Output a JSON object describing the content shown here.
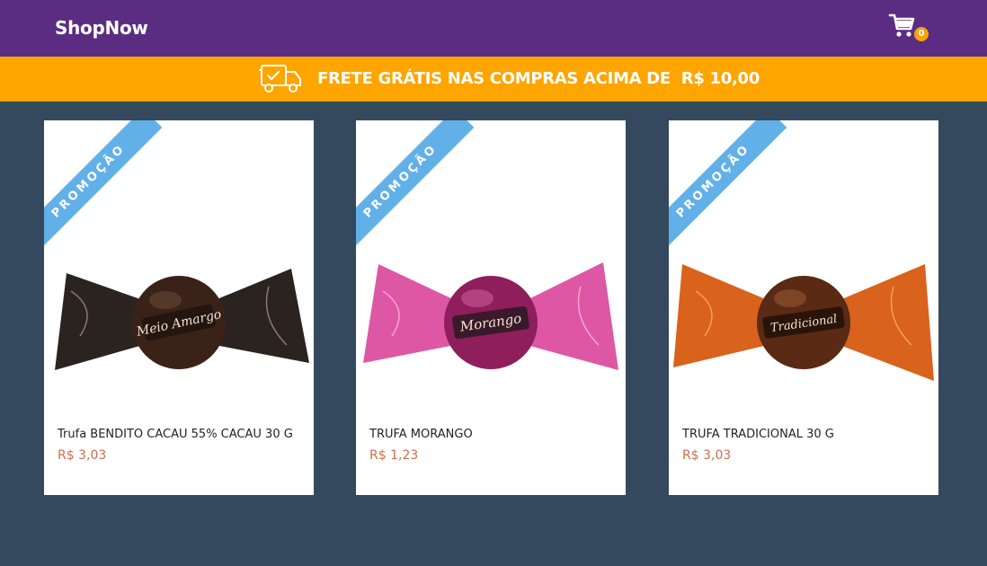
{
  "header": {
    "brand": "ShopNow",
    "cart_count": "0",
    "colors": {
      "bar": "#5b2d82",
      "badge": "#f5a40a"
    }
  },
  "banner": {
    "icon": "delivery-truck-icon",
    "text": "FRETE GRÁTIS NAS COMPRAS ACIMA DE  R$ 10,00",
    "color": "#fea500"
  },
  "products": [
    {
      "badge": "PROMOÇÃO",
      "name": "Trufa BENDITO CACAU 55% CACAU 30 G",
      "price": "R$ 3,03",
      "wrapper_label": "Meio Amargo",
      "wrapper_color": "#2b2320",
      "ball_color": "#3a2218"
    },
    {
      "badge": "PROMOÇÃO",
      "name": "TRUFA MORANGO",
      "price": "R$ 1,23",
      "wrapper_label": "Morango",
      "wrapper_color": "#d83a94",
      "ball_color": "#8e1f5c"
    },
    {
      "badge": "PROMOÇÃO",
      "name": "TRUFA TRADICIONAL 30 G",
      "price": "R$ 3,03",
      "wrapper_label": "Tradicional",
      "wrapper_color": "#d9621c",
      "ball_color": "#5a2a14"
    }
  ]
}
